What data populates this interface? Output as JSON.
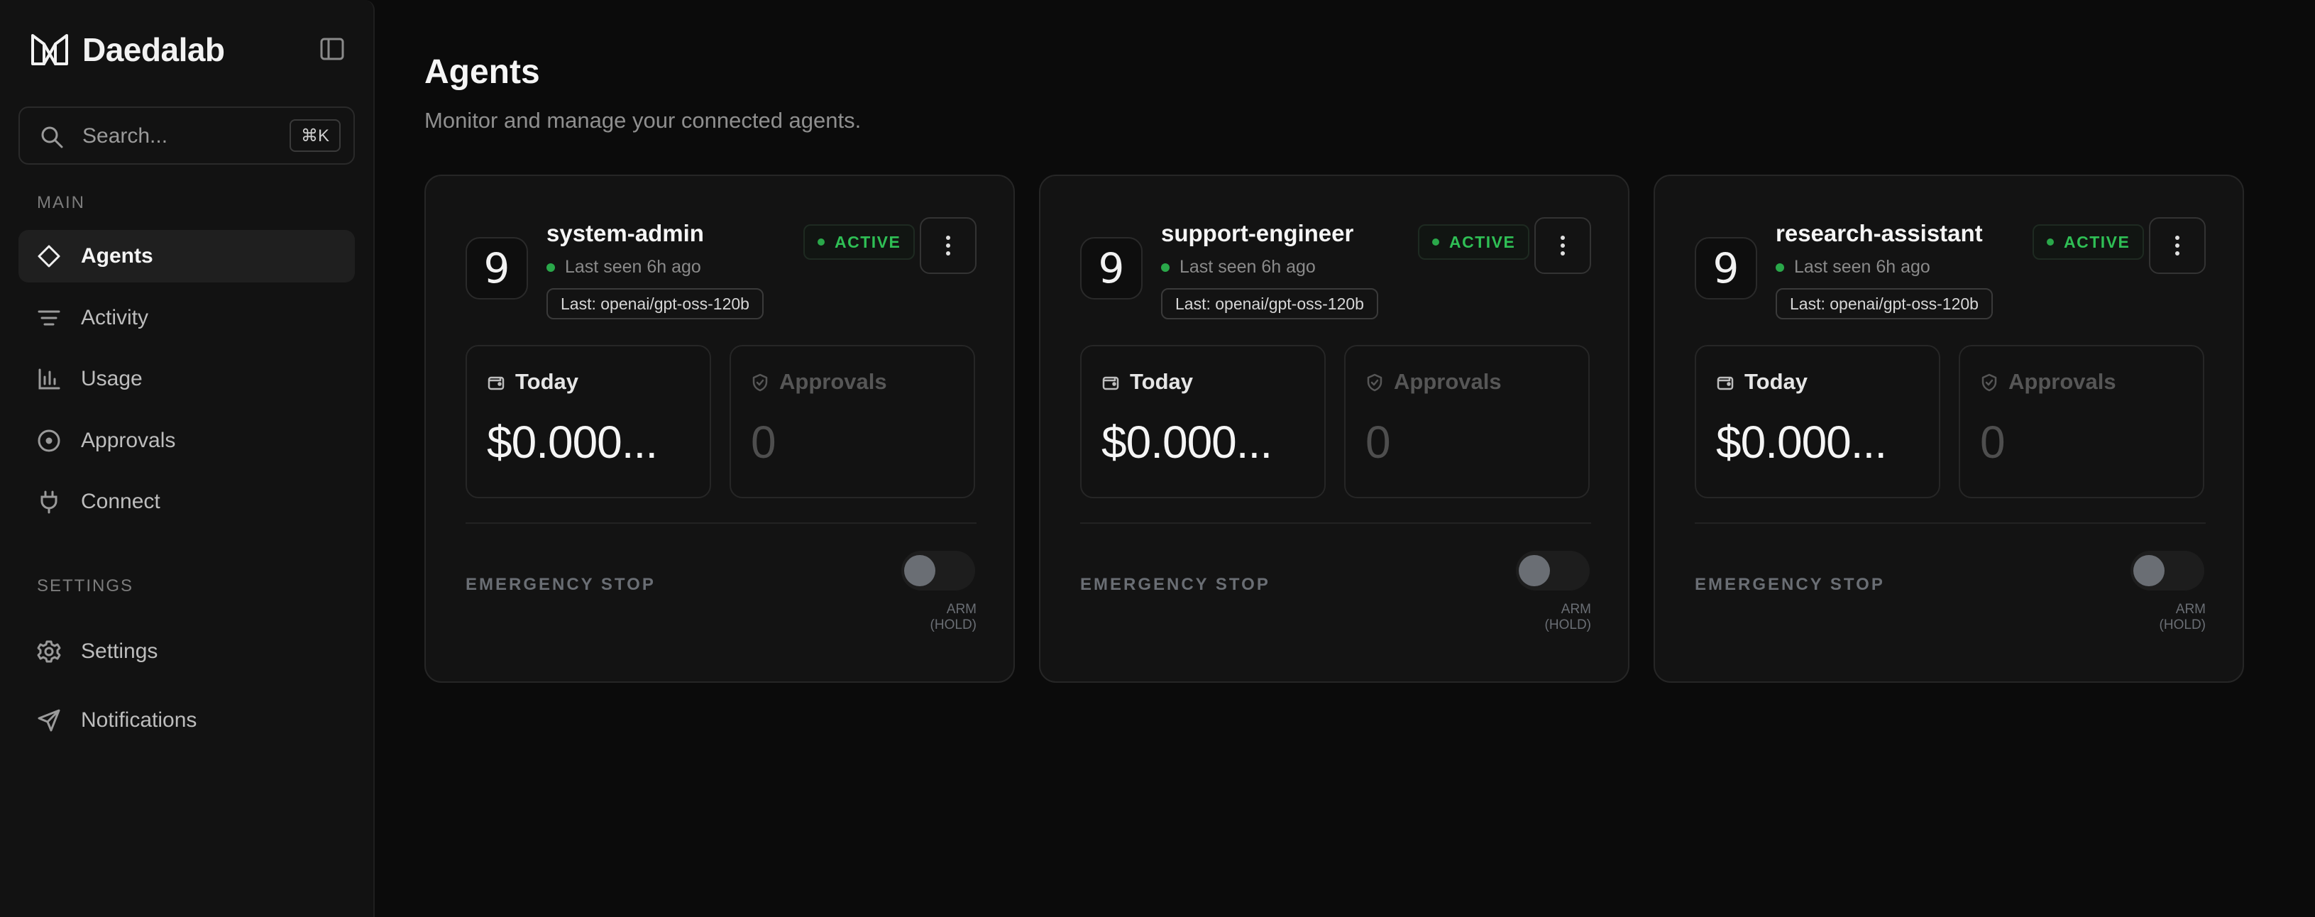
{
  "app": {
    "name": "Daedalab"
  },
  "search": {
    "placeholder": "Search...",
    "shortcut": "⌘K"
  },
  "sidebar": {
    "main_section": "MAIN",
    "settings_section": "SETTINGS",
    "items": [
      {
        "label": "Agents",
        "icon": "diamond-icon",
        "active": true
      },
      {
        "label": "Activity",
        "icon": "filter-lines-icon"
      },
      {
        "label": "Usage",
        "icon": "bar-chart-icon"
      },
      {
        "label": "Approvals",
        "icon": "circle-dot-icon"
      },
      {
        "label": "Connect",
        "icon": "plug-icon"
      }
    ],
    "settings_items": [
      {
        "label": "Settings",
        "icon": "gear-icon"
      },
      {
        "label": "Notifications",
        "icon": "send-icon"
      }
    ]
  },
  "page": {
    "title": "Agents",
    "subtitle": "Monitor and manage your connected agents."
  },
  "agents": [
    {
      "avatar": "9",
      "name": "system-admin",
      "status": "ACTIVE",
      "last_seen": "Last seen 6h ago",
      "model": "Last: openai/gpt-oss-120b",
      "today_label": "Today",
      "today_value": "$0.000...",
      "approvals_label": "Approvals",
      "approvals_value": "0",
      "estop_label": "EMERGENCY STOP",
      "arm_label": "ARM (HOLD)"
    },
    {
      "avatar": "9",
      "name": "support-engineer",
      "status": "ACTIVE",
      "last_seen": "Last seen 6h ago",
      "model": "Last: openai/gpt-oss-120b",
      "today_label": "Today",
      "today_value": "$0.000...",
      "approvals_label": "Approvals",
      "approvals_value": "0",
      "estop_label": "EMERGENCY STOP",
      "arm_label": "ARM (HOLD)"
    },
    {
      "avatar": "9",
      "name": "research-assistant",
      "status": "ACTIVE",
      "last_seen": "Last seen 6h ago",
      "model": "Last: openai/gpt-oss-120b",
      "today_label": "Today",
      "today_value": "$0.000...",
      "approvals_label": "Approvals",
      "approvals_value": "0",
      "estop_label": "EMERGENCY STOP",
      "arm_label": "ARM (HOLD)"
    }
  ],
  "colors": {
    "background": "#0b0b0b",
    "sidebar": "#121212",
    "card": "#131313",
    "active_green": "#2fbf55",
    "muted": "#6a6e74"
  }
}
